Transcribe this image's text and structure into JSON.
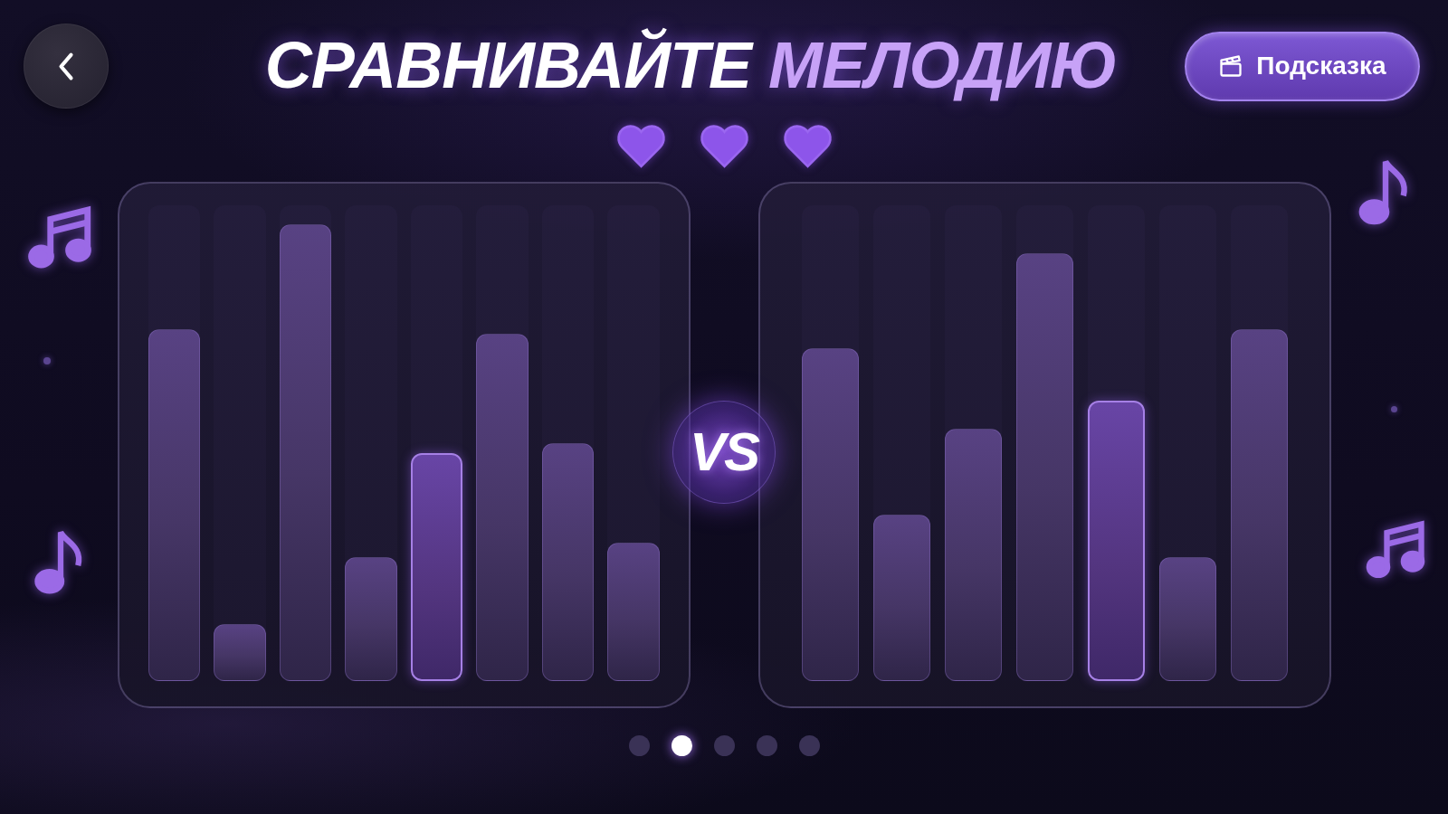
{
  "title": {
    "text": "СРАВНИВАЙТЕ",
    "accent": "МЕЛОДИЮ"
  },
  "hint_button": {
    "label": "Подсказка"
  },
  "lives": [
    {
      "filled": true
    },
    {
      "filled": true
    },
    {
      "filled": true
    }
  ],
  "panels": [
    {
      "bars": [
        {
          "level": 0.74,
          "selected": false
        },
        {
          "level": 0.12,
          "selected": false
        },
        {
          "level": 0.96,
          "selected": false
        },
        {
          "level": 0.26,
          "selected": false
        },
        {
          "level": 0.48,
          "selected": true
        },
        {
          "level": 0.73,
          "selected": false
        },
        {
          "level": 0.5,
          "selected": false
        },
        {
          "level": 0.29,
          "selected": false
        }
      ]
    },
    {
      "bars": [
        {
          "level": 0.7,
          "selected": false
        },
        {
          "level": 0.35,
          "selected": false
        },
        {
          "level": 0.53,
          "selected": false
        },
        {
          "level": 0.9,
          "selected": false
        },
        {
          "level": 0.59,
          "selected": true
        },
        {
          "level": 0.26,
          "selected": false
        },
        {
          "level": 0.74,
          "selected": false
        }
      ]
    }
  ],
  "versus": "VS",
  "pages": [
    {
      "selected": false
    },
    {
      "selected": true
    },
    {
      "selected": false
    },
    {
      "selected": false
    },
    {
      "selected": false
    }
  ]
}
